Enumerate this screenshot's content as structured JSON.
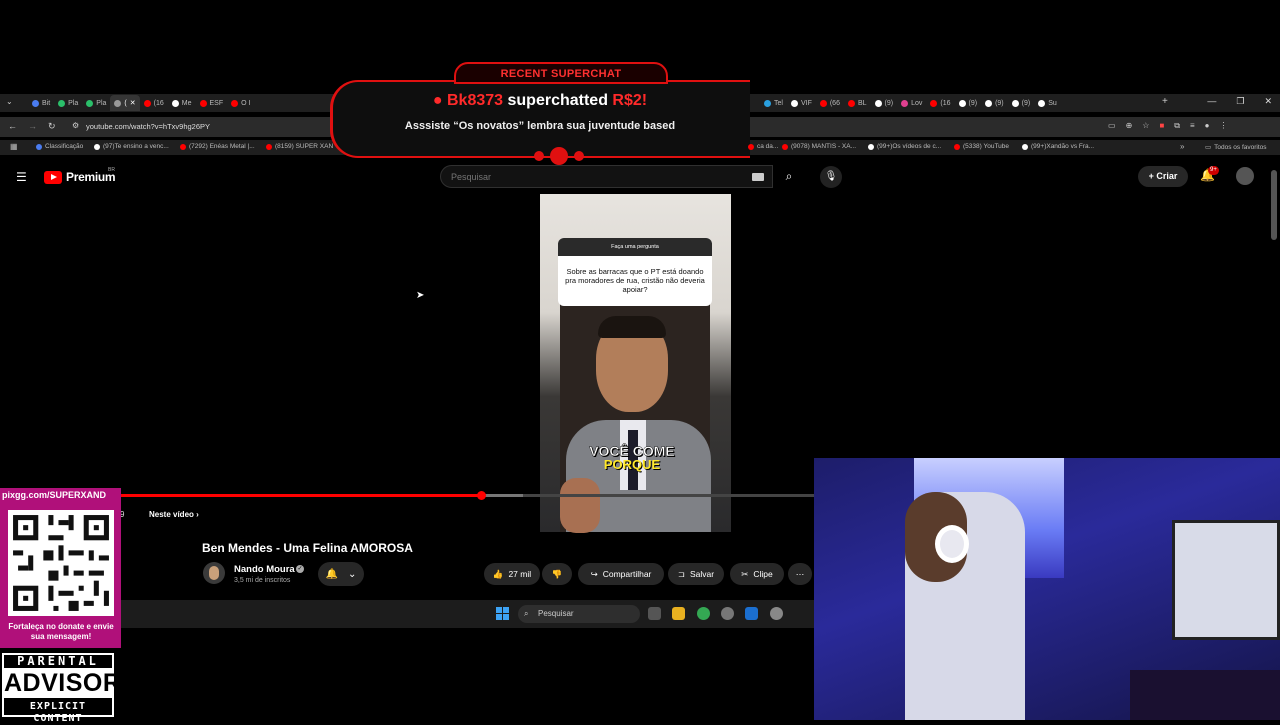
{
  "browser": {
    "tabs_left": [
      {
        "label": "Bit",
        "color": "#4a7cf0"
      },
      {
        "label": "Pla",
        "color": "#2bbf6a"
      },
      {
        "label": "Pla",
        "color": "#2bbf6a"
      },
      {
        "label": "(",
        "color": "#999999",
        "active": true
      },
      {
        "label": "(16",
        "color": "#ff0000"
      },
      {
        "label": "Me",
        "color": "#ffffff"
      },
      {
        "label": "ESF",
        "color": "#ff0000"
      },
      {
        "label": "O I",
        "color": "#ff0000"
      }
    ],
    "tabs_right": [
      {
        "label": "Tel",
        "color": "#2aa0e0"
      },
      {
        "label": "VIF",
        "color": "#ffffff"
      },
      {
        "label": "(66",
        "color": "#ff0000"
      },
      {
        "label": "BL",
        "color": "#ff0000"
      },
      {
        "label": "(9)",
        "color": "#ffffff"
      },
      {
        "label": "Lov",
        "color": "#e04090"
      },
      {
        "label": "(16",
        "color": "#ff0000"
      },
      {
        "label": "(9)",
        "color": "#ffffff"
      },
      {
        "label": "(9)",
        "color": "#ffffff"
      },
      {
        "label": "(9)",
        "color": "#ffffff"
      },
      {
        "label": "Su",
        "color": "#ffffff"
      }
    ],
    "url": "youtube.com/watch?v=hTxv9hg26PY",
    "bookmarks_left": [
      {
        "label": "Classificação",
        "color": "#4a7cf0"
      },
      {
        "label": "(97)Te ensino a venc...",
        "color": "#ffffff"
      },
      {
        "label": "(7292) Enéas Metal |...",
        "color": "#ff0000"
      },
      {
        "label": "(8159) SUPER XAN",
        "color": "#ff0000"
      }
    ],
    "bookmarks_right": [
      {
        "label": "ca da...",
        "color": "#ff0000"
      },
      {
        "label": "(9078) MANTIS - XA...",
        "color": "#ff0000"
      },
      {
        "label": "(99+)Os vídeos de c...",
        "color": "#ffffff"
      },
      {
        "label": "(5338) YouTube",
        "color": "#ff0000"
      },
      {
        "label": "(99+)Xandão vs Fra...",
        "color": "#ffffff"
      }
    ],
    "all_favorites": "Todos os favoritos"
  },
  "superchat": {
    "badge": "RECENT SUPERCHAT",
    "user": "● Bk8373",
    "action": " superchatted ",
    "amount": "R$2!",
    "message": "Asssiste “Os novatos” lembra sua juventude based"
  },
  "youtube": {
    "brand": "Premium",
    "region": "BR",
    "search_placeholder": "Pesquisar",
    "create": "Criar",
    "notifications": "9+"
  },
  "video": {
    "question_header": "Faça uma pergunta",
    "question_text": "Sobre as barracas que o PT está doando pra moradores de rua, cristão não deveria apoiar?",
    "caption_line1": "VOCÊ COME",
    "caption_line2": "PORQUE",
    "progress": 0.52,
    "buffered": 0.58,
    "time_suffix": "9",
    "chapter_label": "Neste vídeo",
    "title": "Ben Mendes - Uma Felina AMOROSA",
    "channel": "Nando Moura",
    "subscribers": "3,5 mi de inscritos",
    "likes": "27 mil",
    "share": "Compartilhar",
    "save": "Salvar",
    "clip": "Clipe"
  },
  "taskbar": {
    "search": "Pesquisar"
  },
  "overlay": {
    "qr_url": "pixgg.com/SUPERXAND",
    "qr_cta": "Fortaleça no donate e envie sua mensagem!",
    "advisory_top": "PARENTAL",
    "advisory_mid": "ADVISORY",
    "advisory_bot": "EXPLICIT CONTENT"
  }
}
